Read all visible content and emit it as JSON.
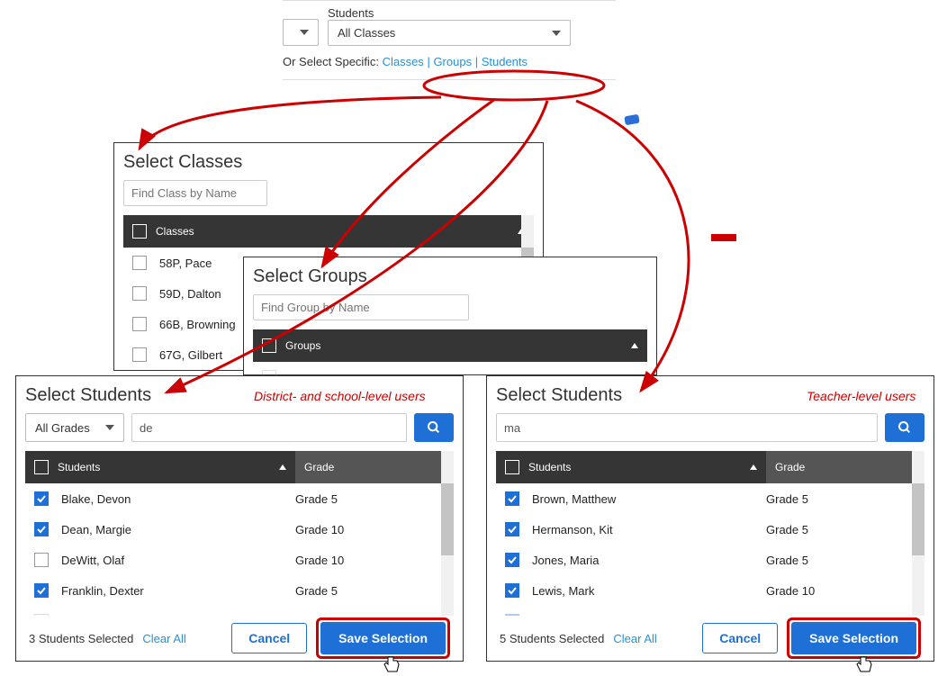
{
  "topbar": {
    "students_label": "Students",
    "all_classes": "All Classes",
    "or_select": "Or Select Specific:",
    "link_classes": "Classes",
    "link_groups": "Groups",
    "link_students": "Students"
  },
  "classes": {
    "title": "Select Classes",
    "placeholder": "Find Class by Name",
    "col_header": "Classes",
    "items": [
      "58P, Pace",
      "59D, Dalton",
      "66B, Browning",
      "67G, Gilbert"
    ]
  },
  "groups": {
    "title": "Select Groups",
    "placeholder": "Find Group by Name",
    "col_header": "Groups"
  },
  "students_left": {
    "title": "Select Students",
    "annotation": "District- and school-level users",
    "grades_dd": "All Grades",
    "search_value": "de",
    "col_students": "Students",
    "col_grade": "Grade",
    "rows": [
      {
        "name": "Blake, Devon",
        "grade": "Grade 5",
        "checked": true
      },
      {
        "name": "Dean, Margie",
        "grade": "Grade 10",
        "checked": true
      },
      {
        "name": "DeWitt, Olaf",
        "grade": "Grade 10",
        "checked": false
      },
      {
        "name": "Franklin, Dexter",
        "grade": "Grade 5",
        "checked": true
      }
    ],
    "selected_text": "3 Students Selected",
    "clear_all": "Clear All",
    "cancel": "Cancel",
    "save": "Save Selection"
  },
  "students_right": {
    "title": "Select Students",
    "annotation": "Teacher-level users",
    "search_value": "ma",
    "col_students": "Students",
    "col_grade": "Grade",
    "rows": [
      {
        "name": "Brown, Matthew",
        "grade": "Grade 5",
        "checked": true
      },
      {
        "name": "Hermanson, Kit",
        "grade": "Grade 5",
        "checked": true
      },
      {
        "name": "Jones, Maria",
        "grade": "Grade 5",
        "checked": true
      },
      {
        "name": "Lewis, Mark",
        "grade": "Grade 10",
        "checked": true
      }
    ],
    "selected_text": "5 Students Selected",
    "clear_all": "Clear All",
    "cancel": "Cancel",
    "save": "Save Selection"
  }
}
